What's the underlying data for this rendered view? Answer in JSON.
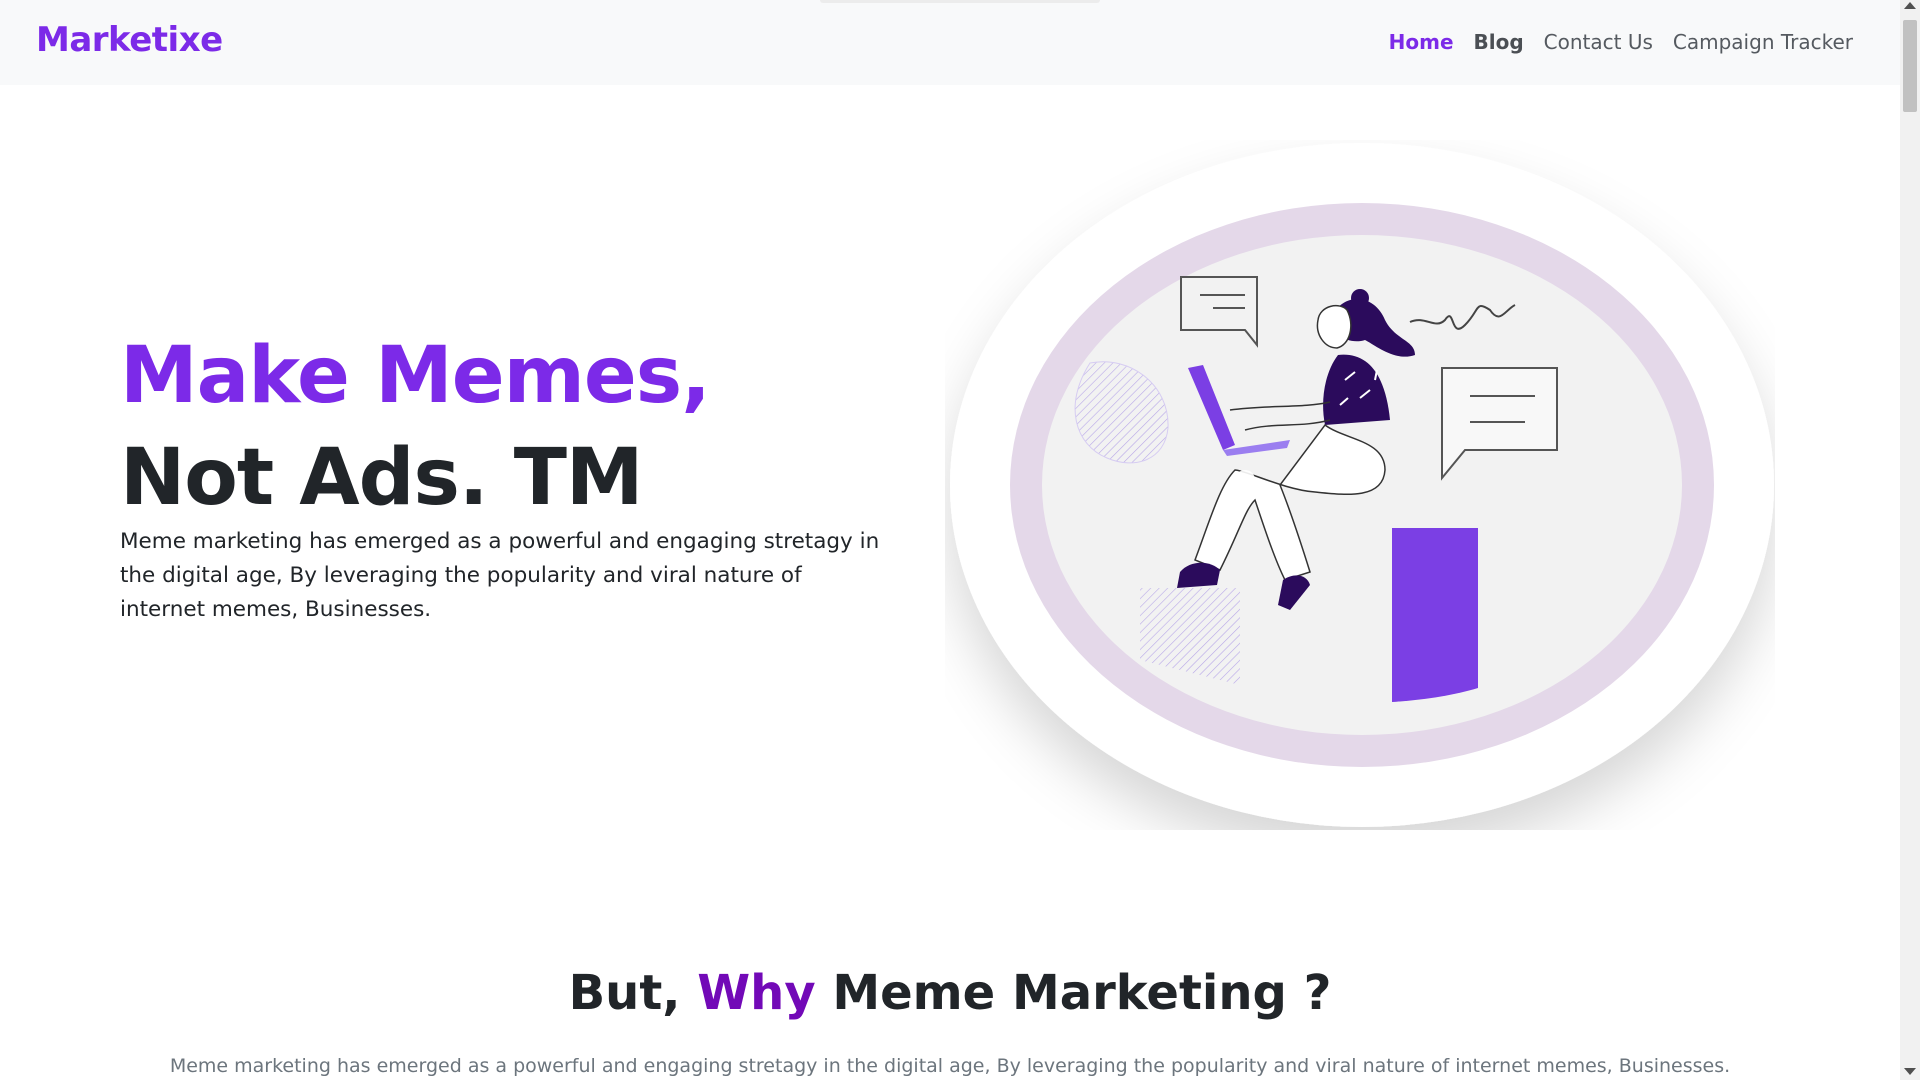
{
  "navbar": {
    "brand": "Marketixe",
    "items": [
      {
        "label": "Home"
      },
      {
        "label": "Blog"
      },
      {
        "label": "Contact Us"
      },
      {
        "label": "Campaign Tracker"
      }
    ]
  },
  "hero": {
    "title_line1": "Make Memes,",
    "title_line2": "Not Ads. TM",
    "description": "Meme marketing has emerged as a powerful and engaging stretagy in the digital age, By leveraging the popularity and viral nature of internet memes, Businesses."
  },
  "why": {
    "title_before": "But, ",
    "title_accent": "Why",
    "title_after": " Meme Marketing ?",
    "description": "Meme marketing has emerged as a powerful and engaging stretagy in the digital age, By leveraging the popularity and viral nature of internet memes, Businesses."
  },
  "colors": {
    "brand": "#7c2ae8",
    "accent": "#7209b7",
    "ring": "#e6d9ea",
    "illustration_fill": "#7b3fe4",
    "figure_dark": "#2b0b5c"
  }
}
